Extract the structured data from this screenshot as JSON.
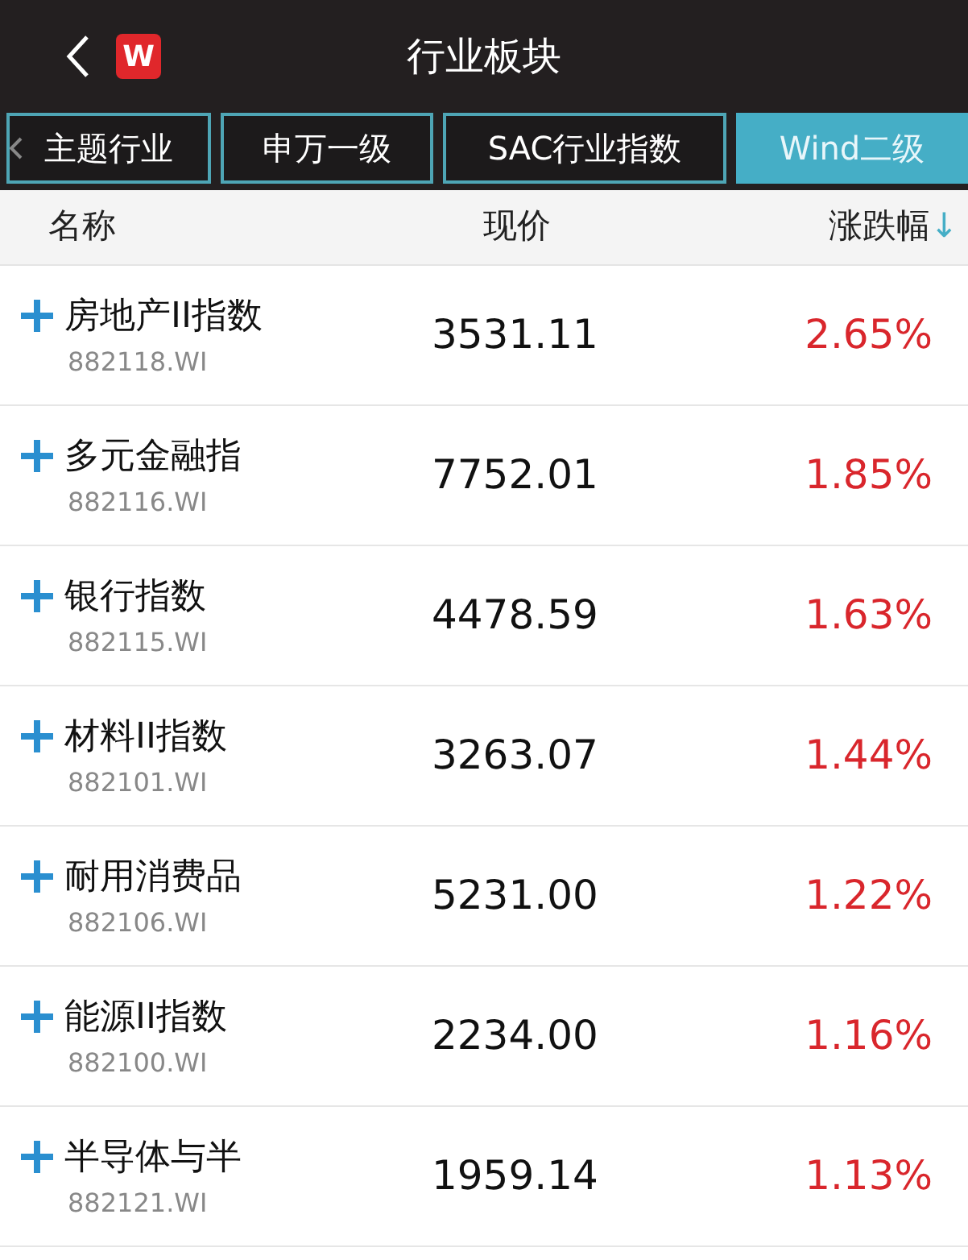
{
  "header": {
    "logo": "W",
    "title": "行业板块"
  },
  "tabs": [
    {
      "label": "主题行业",
      "selected": false
    },
    {
      "label": "申万一级",
      "selected": false
    },
    {
      "label": "SAC行业指数",
      "selected": false
    },
    {
      "label": "Wind二级",
      "selected": true
    }
  ],
  "columns": {
    "name": "名称",
    "price": "现价",
    "change": "涨跌幅",
    "change_sort_icon": "↓"
  },
  "rows": [
    {
      "name": "房地产II指数",
      "code": "882118.WI",
      "price": "3531.11",
      "change": "2.65%"
    },
    {
      "name": "多元金融指",
      "code": "882116.WI",
      "price": "7752.01",
      "change": "1.85%"
    },
    {
      "name": "银行指数",
      "code": "882115.WI",
      "price": "4478.59",
      "change": "1.63%"
    },
    {
      "name": "材料II指数",
      "code": "882101.WI",
      "price": "3263.07",
      "change": "1.44%"
    },
    {
      "name": "耐用消费品",
      "code": "882106.WI",
      "price": "5231.00",
      "change": "1.22%"
    },
    {
      "name": "能源II指数",
      "code": "882100.WI",
      "price": "2234.00",
      "change": "1.16%"
    },
    {
      "name": "半导体与半",
      "code": "882121.WI",
      "price": "1959.14",
      "change": "1.13%"
    }
  ]
}
